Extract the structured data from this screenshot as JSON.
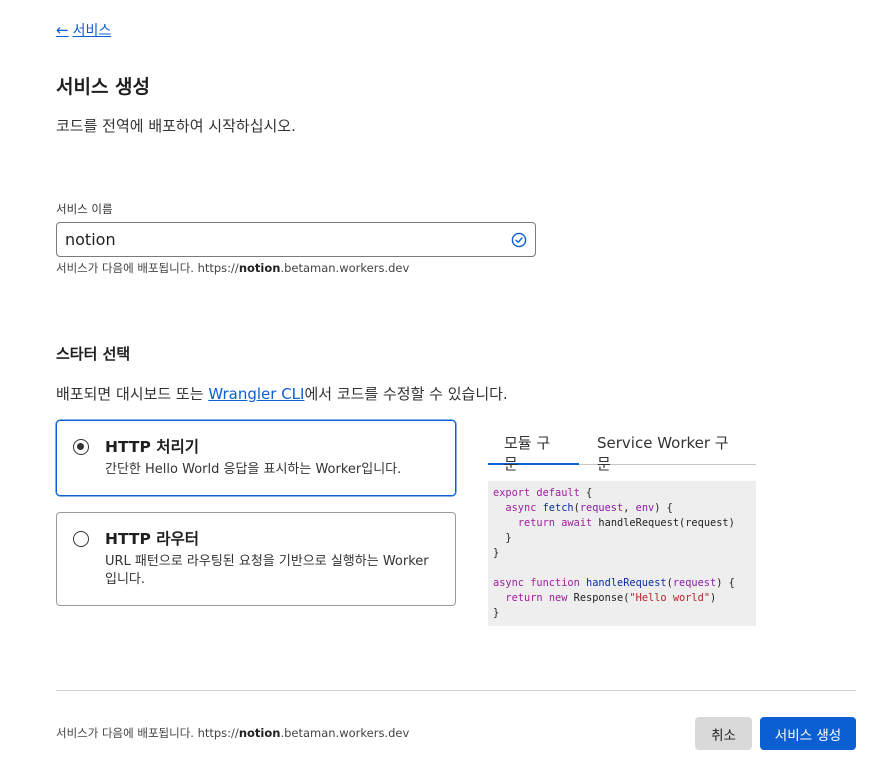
{
  "nav": {
    "back_arrow": "←",
    "back_label": "서비스"
  },
  "header": {
    "title": "서비스 생성",
    "subtitle": "코드를 전역에 배포하여 시작하십시오."
  },
  "service_name": {
    "label": "서비스 이름",
    "value": "notion",
    "hint_prefix": "서비스가 다음에 배포됩니다. https://",
    "hint_name": "notion",
    "hint_suffix": ".betaman.workers.dev",
    "valid_icon": "check-circle-icon"
  },
  "starter": {
    "title": "스타터 선택",
    "desc_prefix": "배포되면 대시보드 또는 ",
    "desc_link": "Wrangler CLI",
    "desc_suffix": "에서 코드를 수정할 수 있습니다.",
    "options": [
      {
        "title": "HTTP 처리기",
        "description": "간단한 Hello World 응답을 표시하는 Worker입니다.",
        "selected": true
      },
      {
        "title": "HTTP 라우터",
        "description": "URL 패턴으로 라우팅된 요청을 기반으로 실행하는 Worker 입니다.",
        "selected": false
      }
    ]
  },
  "code_tabs": {
    "tab_module": "모듈 구문",
    "tab_service_worker": "Service Worker 구문",
    "active": "모듈 구문"
  },
  "code": {
    "export": "export",
    "default": "default",
    "async": "async",
    "fetch": "fetch",
    "request": "request",
    "env": "env",
    "return": "return",
    "await": "await",
    "handleRequest": "handleRequest",
    "function": "function",
    "new": "new",
    "Response": "Response",
    "hello": "\"Hello world\""
  },
  "footer": {
    "hint_prefix": "서비스가 다음에 배포됩니다. https://",
    "hint_name": "notion",
    "hint_suffix": ".betaman.workers.dev",
    "cancel_label": "취소",
    "create_label": "서비스 생성"
  },
  "colors": {
    "accent": "#0b5fd2",
    "cancel_bg": "#d9d9d9",
    "code_bg": "#eeeeee"
  }
}
